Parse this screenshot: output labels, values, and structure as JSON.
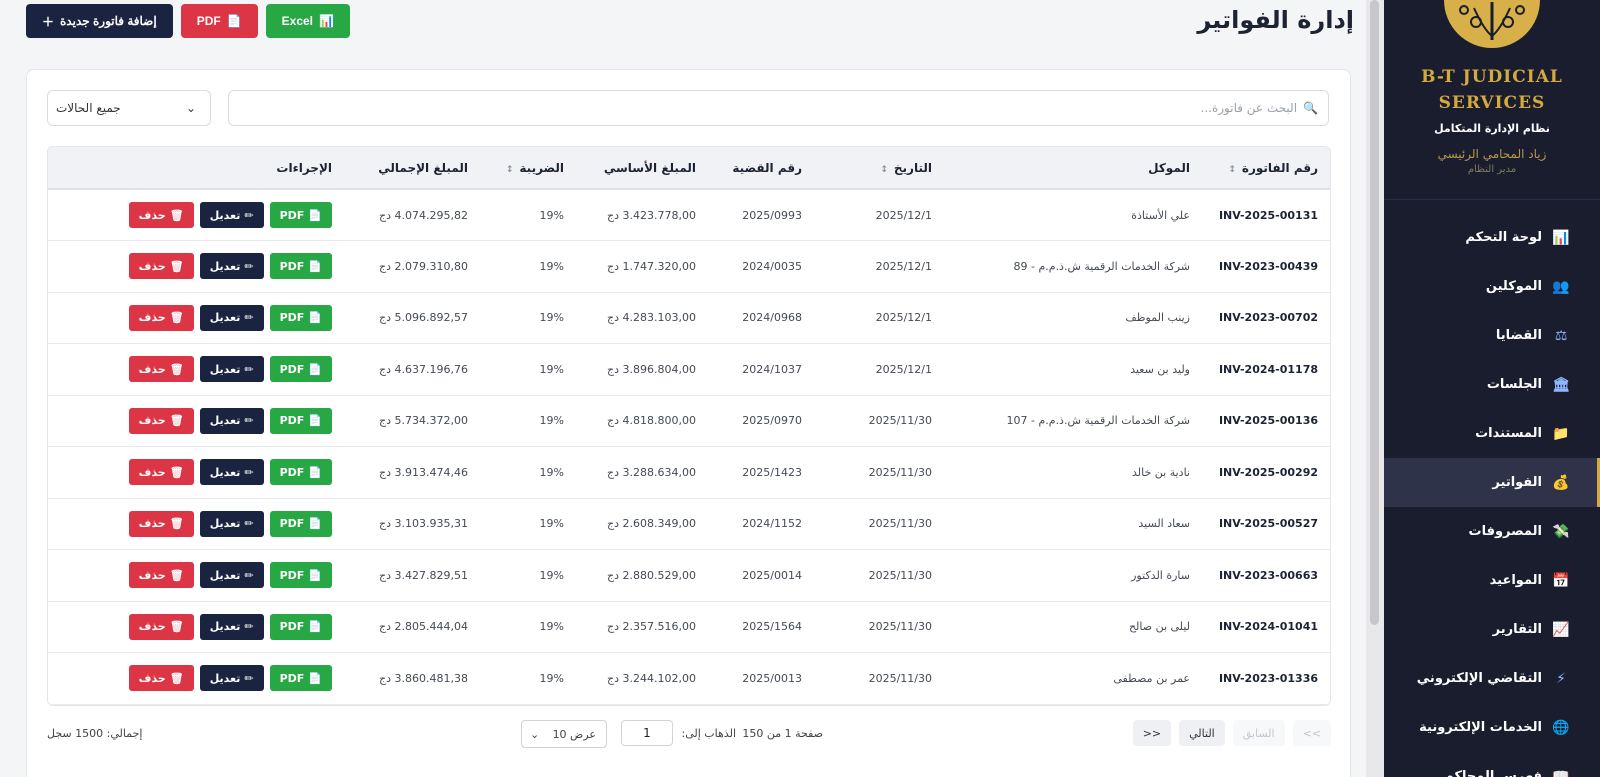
{
  "page": {
    "title": "إدارة الفواتير"
  },
  "toolbar": {
    "add_label": "إضافة فاتورة جديدة",
    "pdf_label": "PDF",
    "excel_label": "Excel"
  },
  "sidebar": {
    "brand_line1": "B-T JUDICIAL",
    "brand_line2": "SERVICES",
    "brand_sub": "نظام الإدارة المتكامل",
    "user_name": "زياد المحامي الرئيسي",
    "user_role": "مدير النظام",
    "items": [
      {
        "label": "لوحة التحكم",
        "icon": "chart-icon",
        "glyph": "📊"
      },
      {
        "label": "الموكلين",
        "icon": "users-icon",
        "glyph": "👥"
      },
      {
        "label": "القضايا",
        "icon": "scales-icon",
        "glyph": "⚖"
      },
      {
        "label": "الجلسات",
        "icon": "court-icon",
        "glyph": "🏛"
      },
      {
        "label": "المستندات",
        "icon": "folder-icon",
        "glyph": "📁"
      },
      {
        "label": "الفواتير",
        "icon": "money-bag-icon",
        "glyph": "💰"
      },
      {
        "label": "المصروفات",
        "icon": "money-wings-icon",
        "glyph": "💸"
      },
      {
        "label": "المواعيد",
        "icon": "calendar-icon",
        "glyph": "📅"
      },
      {
        "label": "التقارير",
        "icon": "trend-chart-icon",
        "glyph": "📈"
      },
      {
        "label": "التقاضي الإلكتروني",
        "icon": "lightning-icon",
        "glyph": "⚡"
      },
      {
        "label": "الخدمات الإلكترونية",
        "icon": "globe-icon",
        "glyph": "🌐"
      },
      {
        "label": "فهرس المحاكم",
        "icon": "book-icon",
        "glyph": "📖"
      }
    ],
    "active_index": 5
  },
  "filters": {
    "search_placeholder": "البحث عن فاتورة...",
    "status_value": "جميع الحالات"
  },
  "table": {
    "headers": [
      "رقم الفاتورة",
      "الموكل",
      "التاريخ",
      "رقم القضية",
      "المبلغ الأساسي",
      "الضريبة",
      "المبلغ الإجمالي",
      "الإجراءات"
    ],
    "action_labels": {
      "pdf": "PDF",
      "edit": "تعديل",
      "delete": "حذف"
    },
    "rows": [
      [
        "INV-2025-00131",
        "علي الأستاذة",
        "2025/12/1",
        "2025/0993",
        "3.423.778,00 دج",
        "19%",
        "4.074.295,82 دج"
      ],
      [
        "INV-2023-00439",
        "شركة الخدمات الرقمية ش.ذ.م.م - 89",
        "2025/12/1",
        "2024/0035",
        "1.747.320,00 دج",
        "19%",
        "2.079.310,80 دج"
      ],
      [
        "INV-2023-00702",
        "زينب الموظف",
        "2025/12/1",
        "2024/0968",
        "4.283.103,00 دج",
        "19%",
        "5.096.892,57 دج"
      ],
      [
        "INV-2024-01178",
        "وليد بن سعيد",
        "2025/12/1",
        "2024/1037",
        "3.896.804,00 دج",
        "19%",
        "4.637.196,76 دج"
      ],
      [
        "INV-2025-00136",
        "شركة الخدمات الرقمية ش.ذ.م.م - 107",
        "2025/11/30",
        "2025/0970",
        "4.818.800,00 دج",
        "19%",
        "5.734.372,00 دج"
      ],
      [
        "INV-2025-00292",
        "نادية بن خالد",
        "2025/11/30",
        "2025/1423",
        "3.288.634,00 دج",
        "19%",
        "3.913.474,46 دج"
      ],
      [
        "INV-2025-00527",
        "سعاد السيد",
        "2025/11/30",
        "2024/1152",
        "2.608.349,00 دج",
        "19%",
        "3.103.935,31 دج"
      ],
      [
        "INV-2023-00663",
        "سارة الدكتور",
        "2025/11/30",
        "2025/0014",
        "2.880.529,00 دج",
        "19%",
        "3.427.829,51 دج"
      ],
      [
        "INV-2024-01041",
        "ليلى بن صالح",
        "2025/11/30",
        "2025/1564",
        "2.357.516,00 دج",
        "19%",
        "2.805.444,04 دج"
      ],
      [
        "INV-2023-01336",
        "عمر بن مصطفى",
        "2025/11/30",
        "2025/0013",
        "3.244.102,00 دج",
        "19%",
        "3.860.481,38 دج"
      ]
    ]
  },
  "pagination": {
    "first": "<<",
    "prev": "السابق",
    "next": "التالي",
    "last": ">>",
    "page_info": "صفحة 1 من 150",
    "goto_label": "الذهاب إلى:",
    "goto_value": "1",
    "per_page": "عرض 10",
    "total": "إجمالي: 1500 سجل"
  },
  "colors": {
    "sidebar_bg": "#1a1d2e",
    "accent_gold": "#d4aa3f",
    "navy": "#1a2340",
    "danger": "#dc3545",
    "success": "#28a745"
  }
}
